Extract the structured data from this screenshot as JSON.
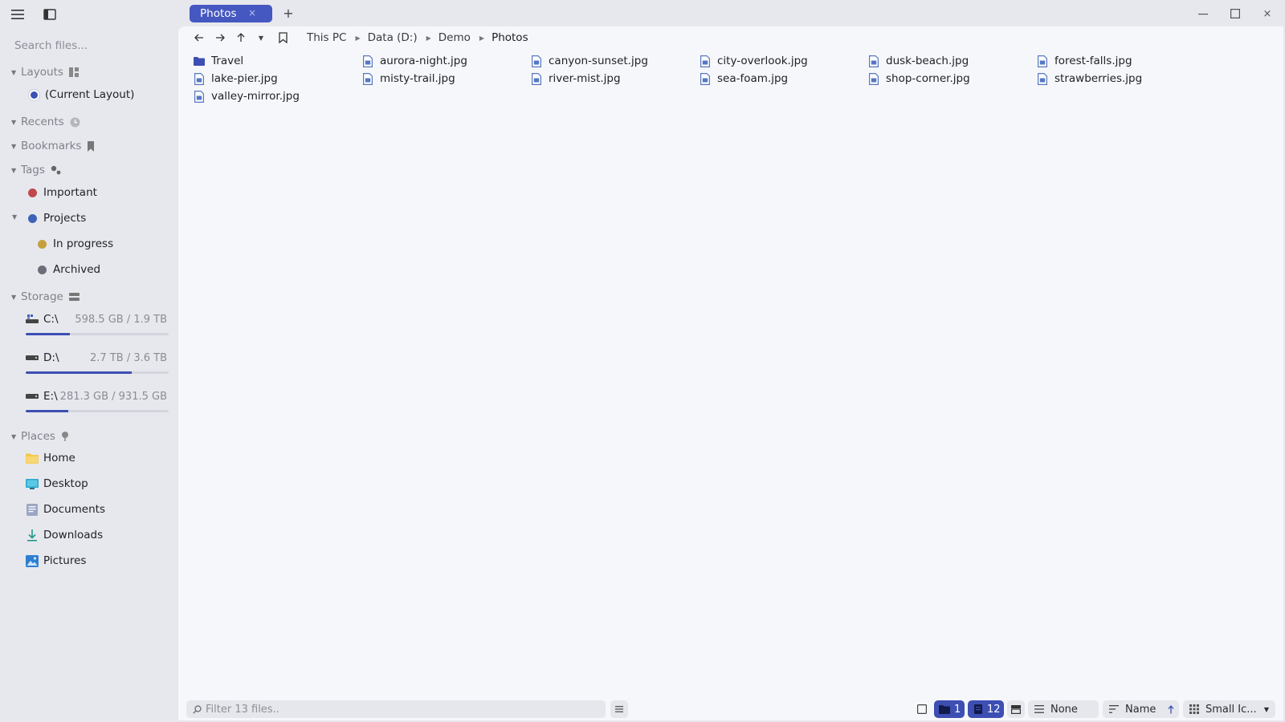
{
  "window": {
    "tab_label": "Photos",
    "tab_close": "×",
    "new_tab": "+",
    "minimize": "—",
    "close": "×"
  },
  "sidebar": {
    "search_placeholder": "Search files...",
    "sections": {
      "layouts": "Layouts",
      "recents": "Recents",
      "bookmarks": "Bookmarks",
      "tags": "Tags",
      "storage": "Storage",
      "places": "Places"
    },
    "layout_items": [
      "(Current Layout)"
    ],
    "tags": [
      {
        "label": "Important",
        "color": "#c0474b"
      },
      {
        "label": "Projects",
        "color": "#3d62b8"
      },
      {
        "label": "In progress",
        "color": "#c5a13d"
      },
      {
        "label": "Archived",
        "color": "#6b6d78"
      }
    ],
    "drives": [
      {
        "name": "C:\\",
        "size": "598.5 GB / 1.9 TB",
        "used_fraction": 0.31
      },
      {
        "name": "D:\\",
        "size": "2.7 TB / 3.6 TB",
        "used_fraction": 0.74
      },
      {
        "name": "E:\\",
        "size": "281.3 GB / 931.5 GB",
        "used_fraction": 0.3
      }
    ],
    "places": [
      "Home",
      "Desktop",
      "Documents",
      "Downloads",
      "Pictures"
    ]
  },
  "breadcrumb": [
    "This PC",
    "Data (D:)",
    "Demo",
    "Photos"
  ],
  "files": [
    {
      "name": "Travel",
      "type": "folder"
    },
    {
      "name": "aurora-night.jpg",
      "type": "file"
    },
    {
      "name": "canyon-sunset.jpg",
      "type": "file"
    },
    {
      "name": "city-overlook.jpg",
      "type": "file"
    },
    {
      "name": "dusk-beach.jpg",
      "type": "file"
    },
    {
      "name": "forest-falls.jpg",
      "type": "file"
    },
    {
      "name": "lake-pier.jpg",
      "type": "file"
    },
    {
      "name": "misty-trail.jpg",
      "type": "file"
    },
    {
      "name": "river-mist.jpg",
      "type": "file"
    },
    {
      "name": "sea-foam.jpg",
      "type": "file"
    },
    {
      "name": "shop-corner.jpg",
      "type": "file"
    },
    {
      "name": "strawberries.jpg",
      "type": "file"
    },
    {
      "name": "valley-mirror.jpg",
      "type": "file"
    }
  ],
  "statusbar": {
    "filter_placeholder": "Filter 13 files..",
    "folder_count": "1",
    "file_count": "12",
    "group_by": "None",
    "sort_by": "Name",
    "view_mode": "Small Ic..."
  },
  "colors": {
    "accent": "#3d4fb3",
    "folder": "#3d4fb3",
    "file_icon": "#5577c4"
  }
}
